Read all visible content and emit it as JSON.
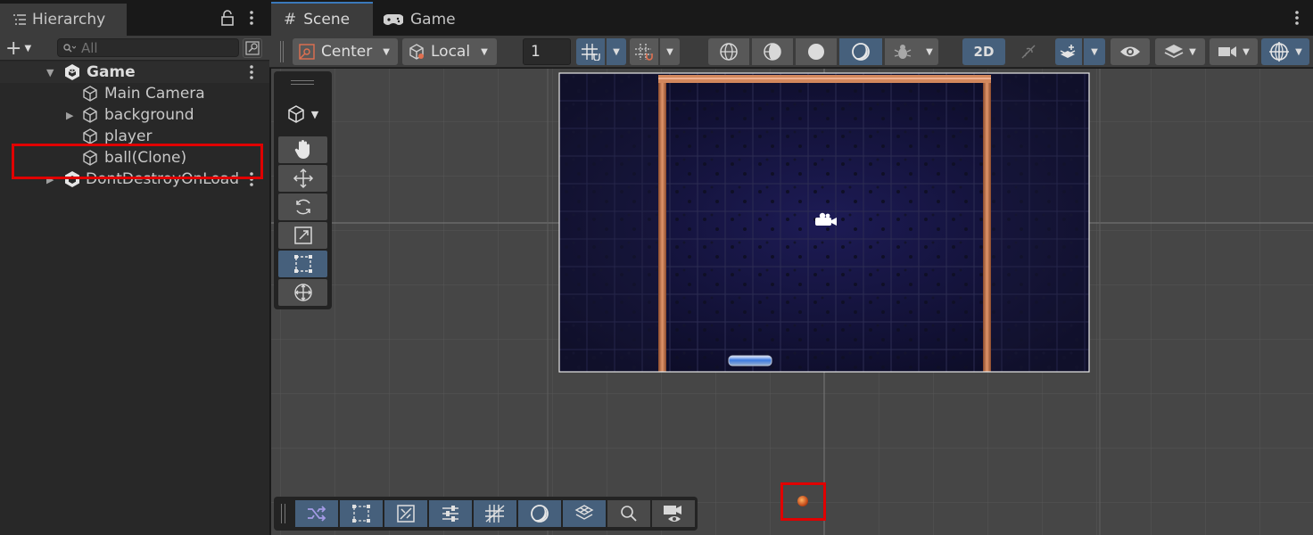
{
  "hierarchy": {
    "title": "Hierarchy",
    "search_placeholder": "All",
    "scene_name": "Game",
    "items": [
      {
        "label": "Main Camera"
      },
      {
        "label": "background"
      },
      {
        "label": "player"
      },
      {
        "label": "ball(Clone)"
      }
    ],
    "ddol": "DontDestroyOnLoad"
  },
  "tabs": {
    "scene": "Scene",
    "game": "Game"
  },
  "toolbar": {
    "pivot": "Center",
    "space": "Local",
    "grid_size": "1",
    "mode_2d": "2D"
  },
  "colors": {
    "highlight": "#e00000",
    "active_blue": "#46607c",
    "panel": "#282828"
  }
}
